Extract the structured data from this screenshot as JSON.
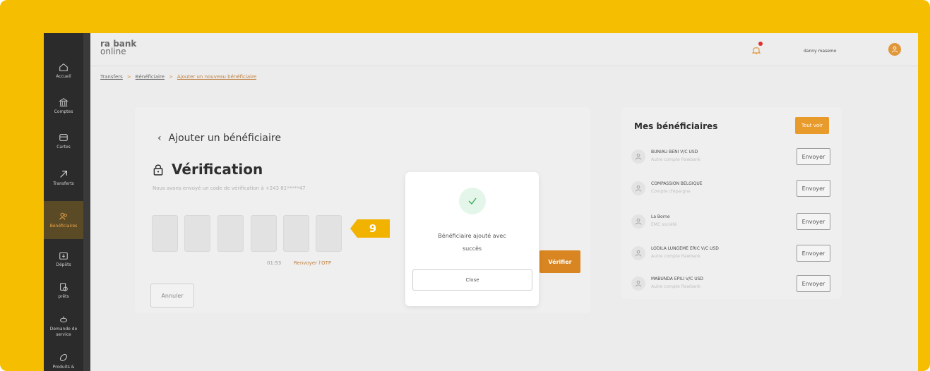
{
  "sidebar": {
    "items": [
      {
        "label": "Accueil",
        "icon": "home-icon"
      },
      {
        "label": "Comptes",
        "icon": "bank-icon"
      },
      {
        "label": "Cartes",
        "icon": "card-icon"
      },
      {
        "label": "Transferts",
        "icon": "transfer-arrow-icon"
      },
      {
        "label": "Bénéficiaires",
        "icon": "users-icon",
        "active": true
      },
      {
        "label": "Dépôts",
        "icon": "deposit-icon"
      },
      {
        "label": "prêts",
        "icon": "loan-icon"
      },
      {
        "label": "Demande de service",
        "icon": "service-icon"
      },
      {
        "label": "Produits &",
        "icon": "product-icon"
      }
    ]
  },
  "header": {
    "logo_line1": "ra bank",
    "logo_line2": "online",
    "username": "danny masemo"
  },
  "breadcrumb": {
    "items": [
      "Transfers",
      "Bénéficiaire",
      "Ajouter un nouveau bénéficiaire"
    ]
  },
  "verification": {
    "back_label": "Ajouter un bénéficiaire",
    "title": "Vérification",
    "subtitle": "Nous avons envoyé un code de vérification à +243 81*****47",
    "timer": "01:53",
    "resend": "Renvoyer l'OTP",
    "cancel": "Annuler",
    "verify": "Vérifier"
  },
  "beneficiaries": {
    "title": "Mes bénéficiaires",
    "see_all": "Tout voir",
    "send_label": "Envoyer",
    "list": [
      {
        "name": "BUNIAU BENI V/C USD",
        "sub": "Autre compte Rawbank"
      },
      {
        "name": "COMPASSION BELGIQUE",
        "sub": "Compte d'épargne"
      },
      {
        "name": "La Borne",
        "sub": "EMC société"
      },
      {
        "name": "LODILA LUNGEME ERIC V/C USD",
        "sub": "Autre compte Rawbank"
      },
      {
        "name": "MABUNDA EPILI V/C USD",
        "sub": "Autre compte Rawbank"
      }
    ]
  },
  "step_badge": "9",
  "modal": {
    "message_line1": "Bénéficiaire ajouté avec",
    "message_line2": "succès",
    "close": "Close"
  },
  "colors": {
    "frame": "#f6be00",
    "accent": "#d98521",
    "sidebar": "#2b2b2b",
    "success": "#3fae5b"
  }
}
